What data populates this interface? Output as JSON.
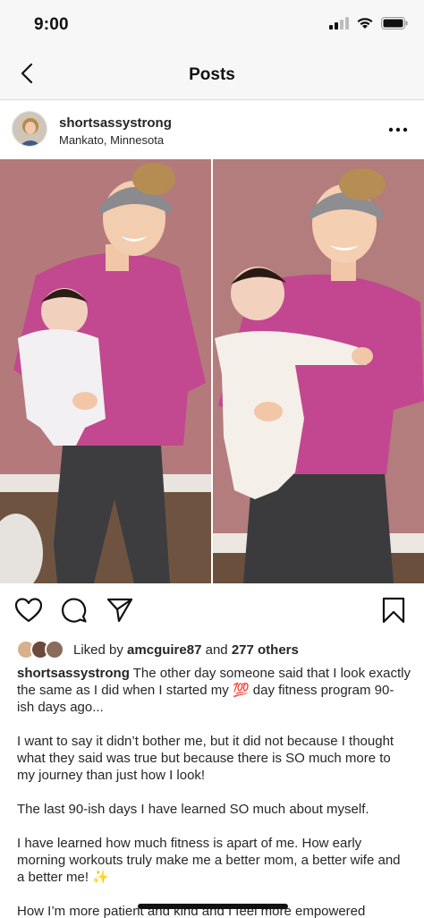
{
  "status_bar": {
    "time": "9:00"
  },
  "nav": {
    "title": "Posts",
    "back_icon": "chevron-left-icon"
  },
  "post": {
    "username": "shortsassystrong",
    "location": "Mankato, Minnesota",
    "more_icon": "more-horizontal-icon"
  },
  "actions": {
    "like_icon": "heart-icon",
    "comment_icon": "comment-icon",
    "share_icon": "send-icon",
    "save_icon": "bookmark-icon"
  },
  "likes": {
    "prefix": "Liked by ",
    "user": "amcguire87",
    "middle": " and ",
    "others": "277 others"
  },
  "caption": {
    "username": "shortsassystrong",
    "line1": " The other day someone said that I look exactly the same as I did when I started my 💯 day fitness program 90-ish days ago...",
    "p2": "I want to say it didn’t bother me, but it did not because I thought what they said was true but because there is SO much more to my journey than just how I look!",
    "p3": "The last 90-ish days I have learned SO much about myself.",
    "p4": "I have learned how much fitness is apart of me. How early morning workouts truly make me a better mom, a better wife and a better me! ✨",
    "p5": "How I’m more patient and kind and I feel more empowered"
  },
  "colors": {
    "wall": "#b27a7d",
    "shirt": "#c2478f",
    "leggings": "#3b3b3d",
    "floor": "#6b4f3a"
  }
}
